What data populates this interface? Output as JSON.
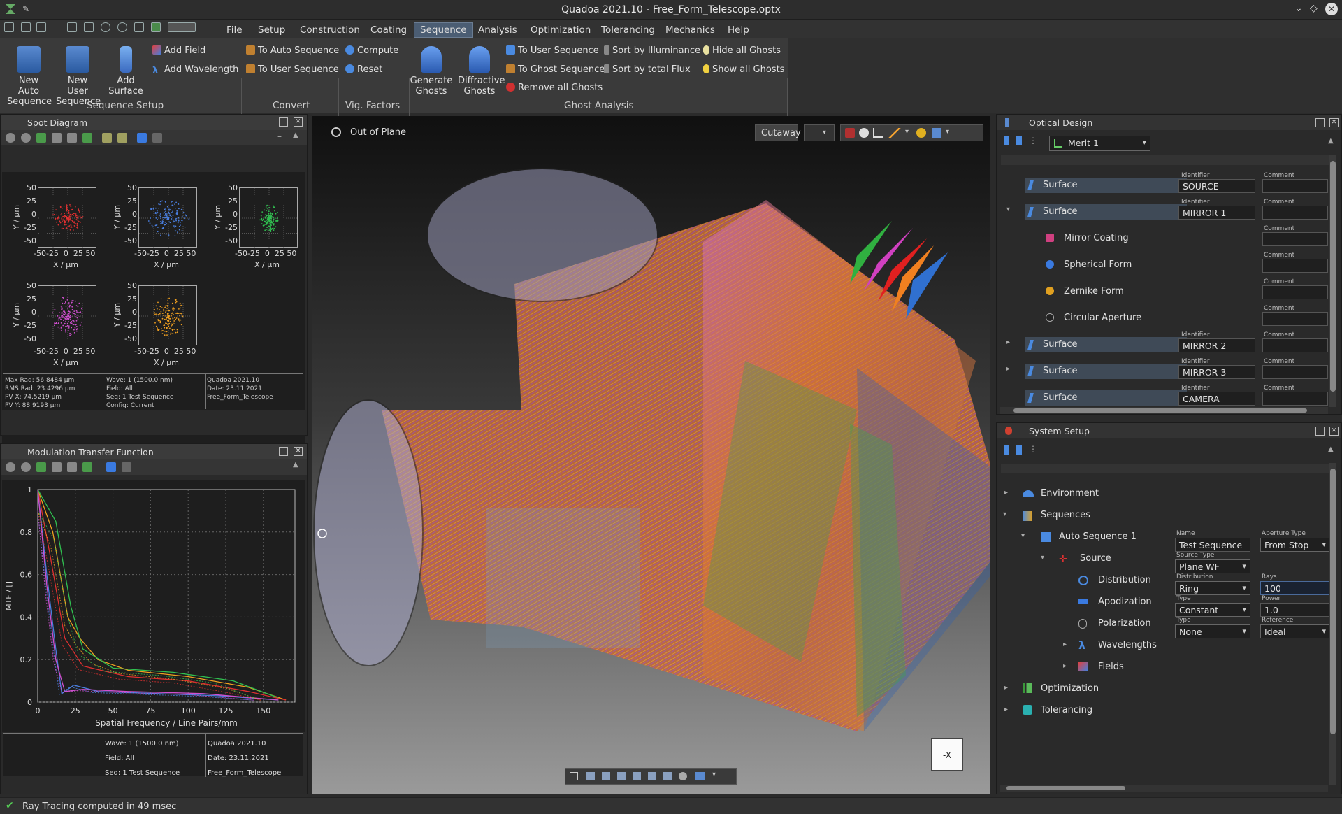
{
  "window": {
    "title": "Quadoa 2021.10 - Free_Form_Telescope.optx"
  },
  "menu": [
    "File",
    "Setup",
    "Construction",
    "Coating",
    "Sequence",
    "Analysis",
    "Optimization",
    "Tolerancing",
    "Mechanics",
    "Help"
  ],
  "ribbon": {
    "new_auto": "New Auto",
    "new_auto2": "Sequence",
    "new_user": "New User",
    "new_user2": "Sequence",
    "add_surface": "Add",
    "add_surface2": "Surface",
    "add_field": "Add Field",
    "add_wavelength": "Add Wavelength",
    "group_sequence": "Sequence Setup",
    "to_auto": "To Auto Sequence",
    "to_user": "To User Sequence",
    "group_convert": "Convert",
    "compute": "Compute",
    "reset": "Reset",
    "group_vig": "Vig. Factors",
    "gen_ghosts": "Generate",
    "gen_ghosts2": "Ghosts",
    "diff_ghosts": "Diffractive",
    "diff_ghosts2": "Ghosts",
    "to_user_seq": "To User Sequence",
    "to_ghost_seq": "To Ghost Sequence",
    "remove_ghosts": "Remove all Ghosts",
    "sort_illum": "Sort by Illuminance",
    "sort_flux": "Sort by total Flux",
    "hide_ghosts": "Hide all Ghosts",
    "show_ghosts": "Show all Ghosts",
    "group_ghost": "Ghost Analysis"
  },
  "spot": {
    "title": "Spot Diagram",
    "ylabel": "Y / µm",
    "xlabel": "X / µm",
    "yticks": [
      "50",
      "25",
      "0",
      "-25",
      "-50"
    ],
    "xticks": "-50-25  0  25 50",
    "colors": [
      "#e03030",
      "#4a7fe0",
      "#30c050",
      "#d050d0",
      "#f0a020"
    ],
    "info_left": [
      "Max Rad: 56.8484 µm",
      "RMS Rad: 23.4296 µm",
      "PV X: 74.5219 µm",
      "PV Y: 88.9193 µm"
    ],
    "info_mid": [
      "Wave: 1 (1500.0 nm)",
      "Field: All",
      "Seq: 1 Test Sequence",
      "Config: Current"
    ],
    "info_right": [
      "Quadoa 2021.10",
      "Date: 23.11.2021",
      "Free_Form_Telescope"
    ]
  },
  "mtf": {
    "title": "Modulation Transfer Function",
    "ylabel": "MTF / []",
    "xlabel": "Spatial Frequency / Line Pairs/mm",
    "yticks": [
      "1",
      "0.8",
      "0.6",
      "0.4",
      "0.2",
      "0"
    ],
    "xticks": [
      "0",
      "25",
      "50",
      "75",
      "100",
      "125",
      "150"
    ],
    "info_left": [
      "Wave: 1 (1500.0 nm)",
      "Field: All",
      "Seq: 1 Test Sequence"
    ],
    "info_right": [
      "Quadoa 2021.10",
      "Date: 23.11.2021",
      "Free_Form_Telescope"
    ]
  },
  "view3d": {
    "label": "Out of Plane",
    "cutaway": "Cutaway",
    "cube": "-X"
  },
  "optical": {
    "title": "Optical Design",
    "merit": "Merit 1",
    "identifier": "Identifier",
    "comment": "Comment",
    "rows": [
      {
        "label": "Surface",
        "id": "SOURCE"
      },
      {
        "label": "Surface",
        "id": "MIRROR 1"
      },
      {
        "label": "Mirror Coating"
      },
      {
        "label": "Spherical Form"
      },
      {
        "label": "Zernike Form"
      },
      {
        "label": "Circular Aperture"
      },
      {
        "label": "Surface",
        "id": "MIRROR 2"
      },
      {
        "label": "Surface",
        "id": "MIRROR 3"
      },
      {
        "label": "Surface",
        "id": "CAMERA"
      }
    ]
  },
  "system": {
    "title": "System Setup",
    "environment": "Environment",
    "sequences": "Sequences",
    "auto_seq": "Auto Sequence 1",
    "name_h": "Name",
    "name": "Test Sequence",
    "aperture_h": "Aperture Type",
    "aperture": "From Stop",
    "source": "Source",
    "source_type_h": "Source Type",
    "source_type": "Plane WF",
    "distribution": "Distribution",
    "distribution_h": "Distribution",
    "distribution_v": "Ring",
    "rays_h": "Rays",
    "rays": "100",
    "apodization": "Apodization",
    "type_h": "Type",
    "apod_v": "Constant",
    "power_h": "Power",
    "power": "1.0",
    "polarization": "Polarization",
    "pol_v": "None",
    "ref_h": "Reference",
    "ref": "Ideal",
    "wavelengths": "Wavelengths",
    "fields": "Fields",
    "optimization": "Optimization",
    "tolerancing": "Tolerancing"
  },
  "status": {
    "text": "Ray Tracing computed in 49 msec"
  }
}
